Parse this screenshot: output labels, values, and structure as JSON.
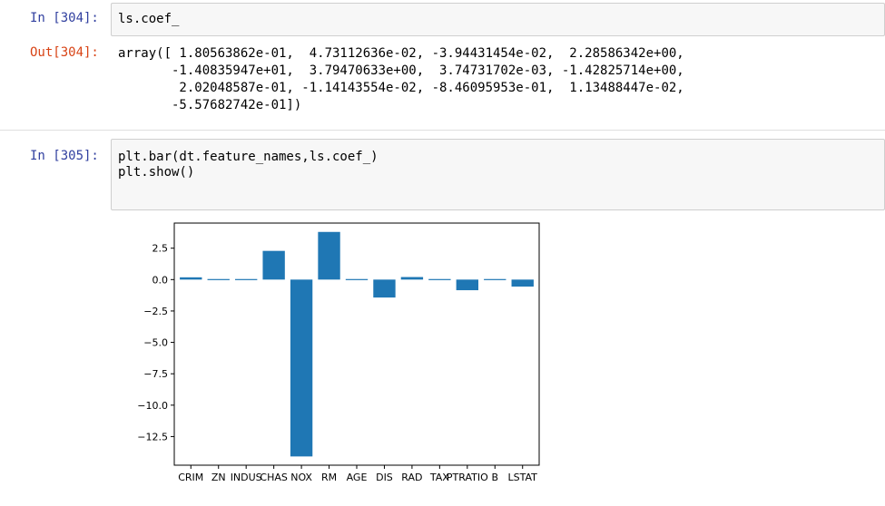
{
  "cell1": {
    "in_prompt": "In [304]:",
    "code_lines": [
      "ls.coef_"
    ],
    "out_prompt": "Out[304]:",
    "output_lines": [
      "array([ 1.80563862e-01,  4.73112636e-02, -3.94431454e-02,  2.28586342e+00,",
      "       -1.40835947e+01,  3.79470633e+00,  3.74731702e-03, -1.42825714e+00,",
      "        2.02048587e-01, -1.14143554e-02, -8.46095953e-01,  1.13488447e-02,",
      "       -5.57682742e-01])"
    ]
  },
  "cell2": {
    "in_prompt": "In [305]:",
    "code_lines": [
      "plt.bar(dt.feature_names,ls.coef_)",
      "plt.show()"
    ]
  },
  "colors": {
    "bar": "#1f77b4",
    "in_prompt": "#303f9f",
    "out_prompt": "#d84315"
  },
  "chart_data": {
    "type": "bar",
    "categories": [
      "CRIM",
      "ZN",
      "INDUS",
      "CHAS",
      "NOX",
      "RM",
      "AGE",
      "DIS",
      "RAD",
      "TAX",
      "PTRATIO",
      "B",
      "LSTAT"
    ],
    "values": [
      0.180563862,
      0.0473112636,
      -0.0394431454,
      2.28586342,
      -14.0835947,
      3.79470633,
      0.00374731702,
      -1.42825714,
      0.202048587,
      -0.0114143554,
      -0.846095953,
      0.0113488447,
      -0.557682742
    ],
    "ylim": [
      -14.78,
      4.5
    ],
    "yticks": [
      2.5,
      0.0,
      -2.5,
      -5.0,
      -7.5,
      -10.0,
      -12.5
    ],
    "ytick_labels": [
      "2.5",
      "0.0",
      "−2.5",
      "−5.0",
      "−7.5",
      "−10.0",
      "−12.5"
    ],
    "title": "",
    "xlabel": "",
    "ylabel": "",
    "grid": false,
    "legend": false
  }
}
